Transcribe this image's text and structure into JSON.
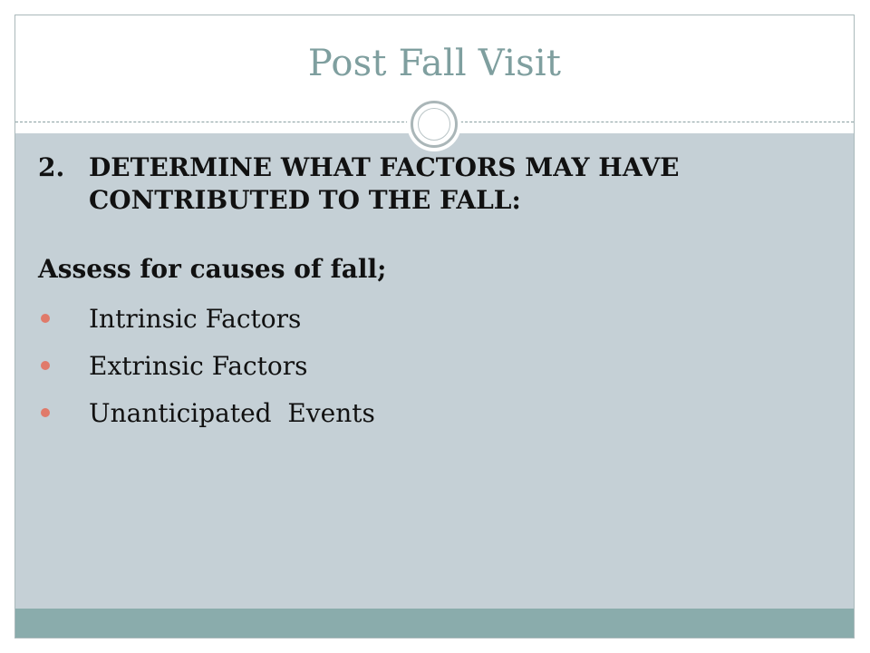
{
  "slide": {
    "title": "Post Fall Visit",
    "heading_number": "2.",
    "heading_text": "DETERMINE WHAT FACTORS MAY HAVE CONTRIBUTED TO THE FALL:",
    "subheading": "Assess for causes of fall;",
    "bullets": [
      "Intrinsic Factors",
      "Extrinsic Factors",
      "Unanticipated  Events"
    ]
  },
  "colors": {
    "title": "#7f9f9f",
    "content_background": "#c5d0d6",
    "footer_band": "#8aacac",
    "bullet": "#e07a6a"
  },
  "icons": {
    "divider_ornament": "circle-ornament-icon",
    "bullet": "bullet-dot-icon"
  }
}
